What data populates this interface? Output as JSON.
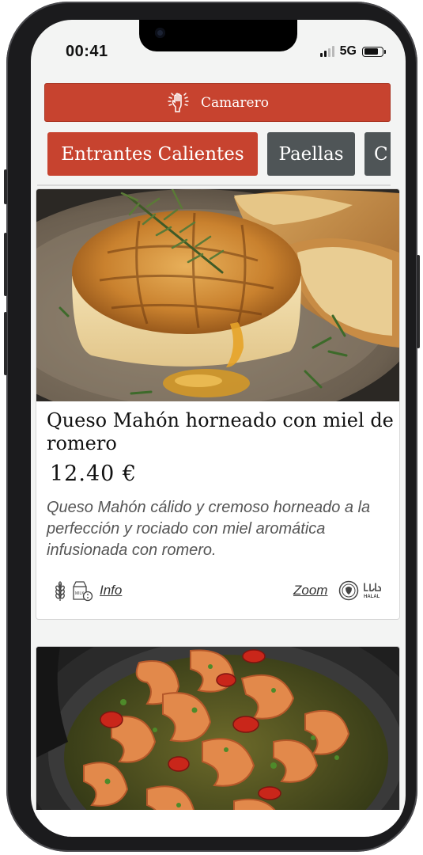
{
  "status_bar": {
    "time": "00:41",
    "network": "5G"
  },
  "waiter_button": {
    "label": "Camarero",
    "icon": "raised-hand-icon"
  },
  "categories": {
    "tabs": [
      {
        "label": "Entrantes Calientes",
        "active": true
      },
      {
        "label": "Paellas",
        "active": false
      },
      {
        "label": "C",
        "active": false
      }
    ]
  },
  "dishes": [
    {
      "name": "Queso Mahón horneado con miel de romero",
      "price": "12.40 €",
      "description": "Queso Mahón cálido y cremoso horneado a la perfección y rociado con miel aromática infusionada con romero.",
      "allergen_icons": [
        "gluten-wheat-icon",
        "milk-icon"
      ],
      "info_label": "Info",
      "zoom_label": "Zoom",
      "diet_icons": [
        "vegetarian-seal-icon",
        "halal-icon"
      ],
      "halal_text": "HALAL"
    },
    {
      "image": "garlic-shrimp-pan-photo"
    }
  ],
  "colors": {
    "accent": "#c7432f",
    "tab_inactive": "#4f5557",
    "background": "#f3f4f3"
  }
}
